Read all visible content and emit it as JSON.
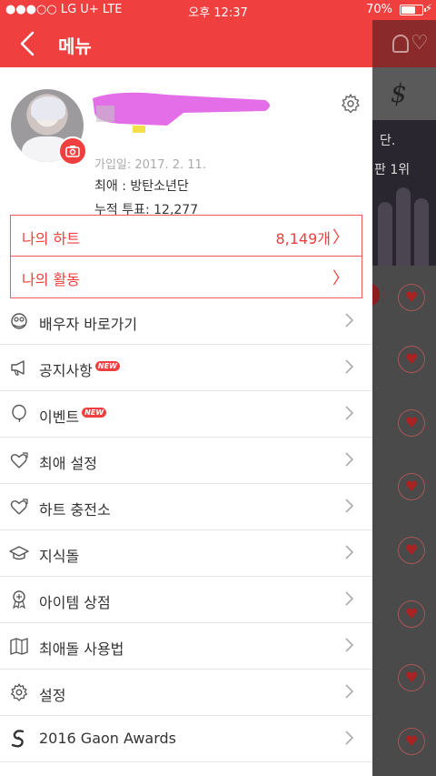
{
  "status_bar": {
    "carrier": "●●●○○ LG U+  LTE",
    "time": "오후 12:37",
    "battery_percent": "70%",
    "battery_level": 0.7
  },
  "drawer": {
    "title": "메뉴",
    "profile": {
      "join_date": "가입일: 2017. 2. 11.",
      "favorite": "최애 : 방탄소년단",
      "total_votes": "누적 투표: 12,277"
    },
    "my_hearts": {
      "label": "나의 하트",
      "value": "8,149개"
    },
    "my_activity": {
      "label": "나의 활동"
    },
    "menu_items": [
      {
        "label": "배우자 바로가기",
        "icon": "couple-icon"
      },
      {
        "label": "공지사항",
        "icon": "megaphone-icon",
        "badge": "NEW"
      },
      {
        "label": "이벤트",
        "icon": "balloon-icon",
        "badge": "NEW"
      },
      {
        "label": "최애 설정",
        "icon": "heart-arrow-icon"
      },
      {
        "label": "하트 충전소",
        "icon": "heart-arrow-icon"
      },
      {
        "label": "지식돌",
        "icon": "graduation-cap-icon"
      },
      {
        "label": "아이템 상점",
        "icon": "medal-icon"
      },
      {
        "label": "최애돌 사용법",
        "icon": "map-icon"
      },
      {
        "label": "설정",
        "icon": "gear-icon"
      },
      {
        "label": "2016 Gaon Awards",
        "icon": "gaon-logo-icon"
      }
    ]
  },
  "background": {
    "banner_line1": "단.",
    "banner_line2": "판 1위"
  },
  "colors": {
    "accent": "#ef3f3f",
    "text": "#333333",
    "muted": "#aaaaaa",
    "divider": "#e6e6e6"
  }
}
